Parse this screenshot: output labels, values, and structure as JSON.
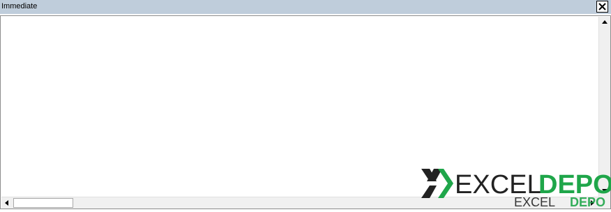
{
  "window": {
    "title": "Immediate",
    "close_label": "×"
  },
  "editor": {
    "value": ""
  },
  "watermark": {
    "brand_left": "EXCEL",
    "brand_right": "DEPO",
    "colors": {
      "dark": "#222222",
      "green": "#1fa64a"
    }
  },
  "scrollbars": {
    "up_icon": "arrow-up-icon",
    "down_icon": "arrow-down-icon",
    "left_icon": "arrow-left-icon",
    "right_icon": "arrow-right-icon"
  }
}
